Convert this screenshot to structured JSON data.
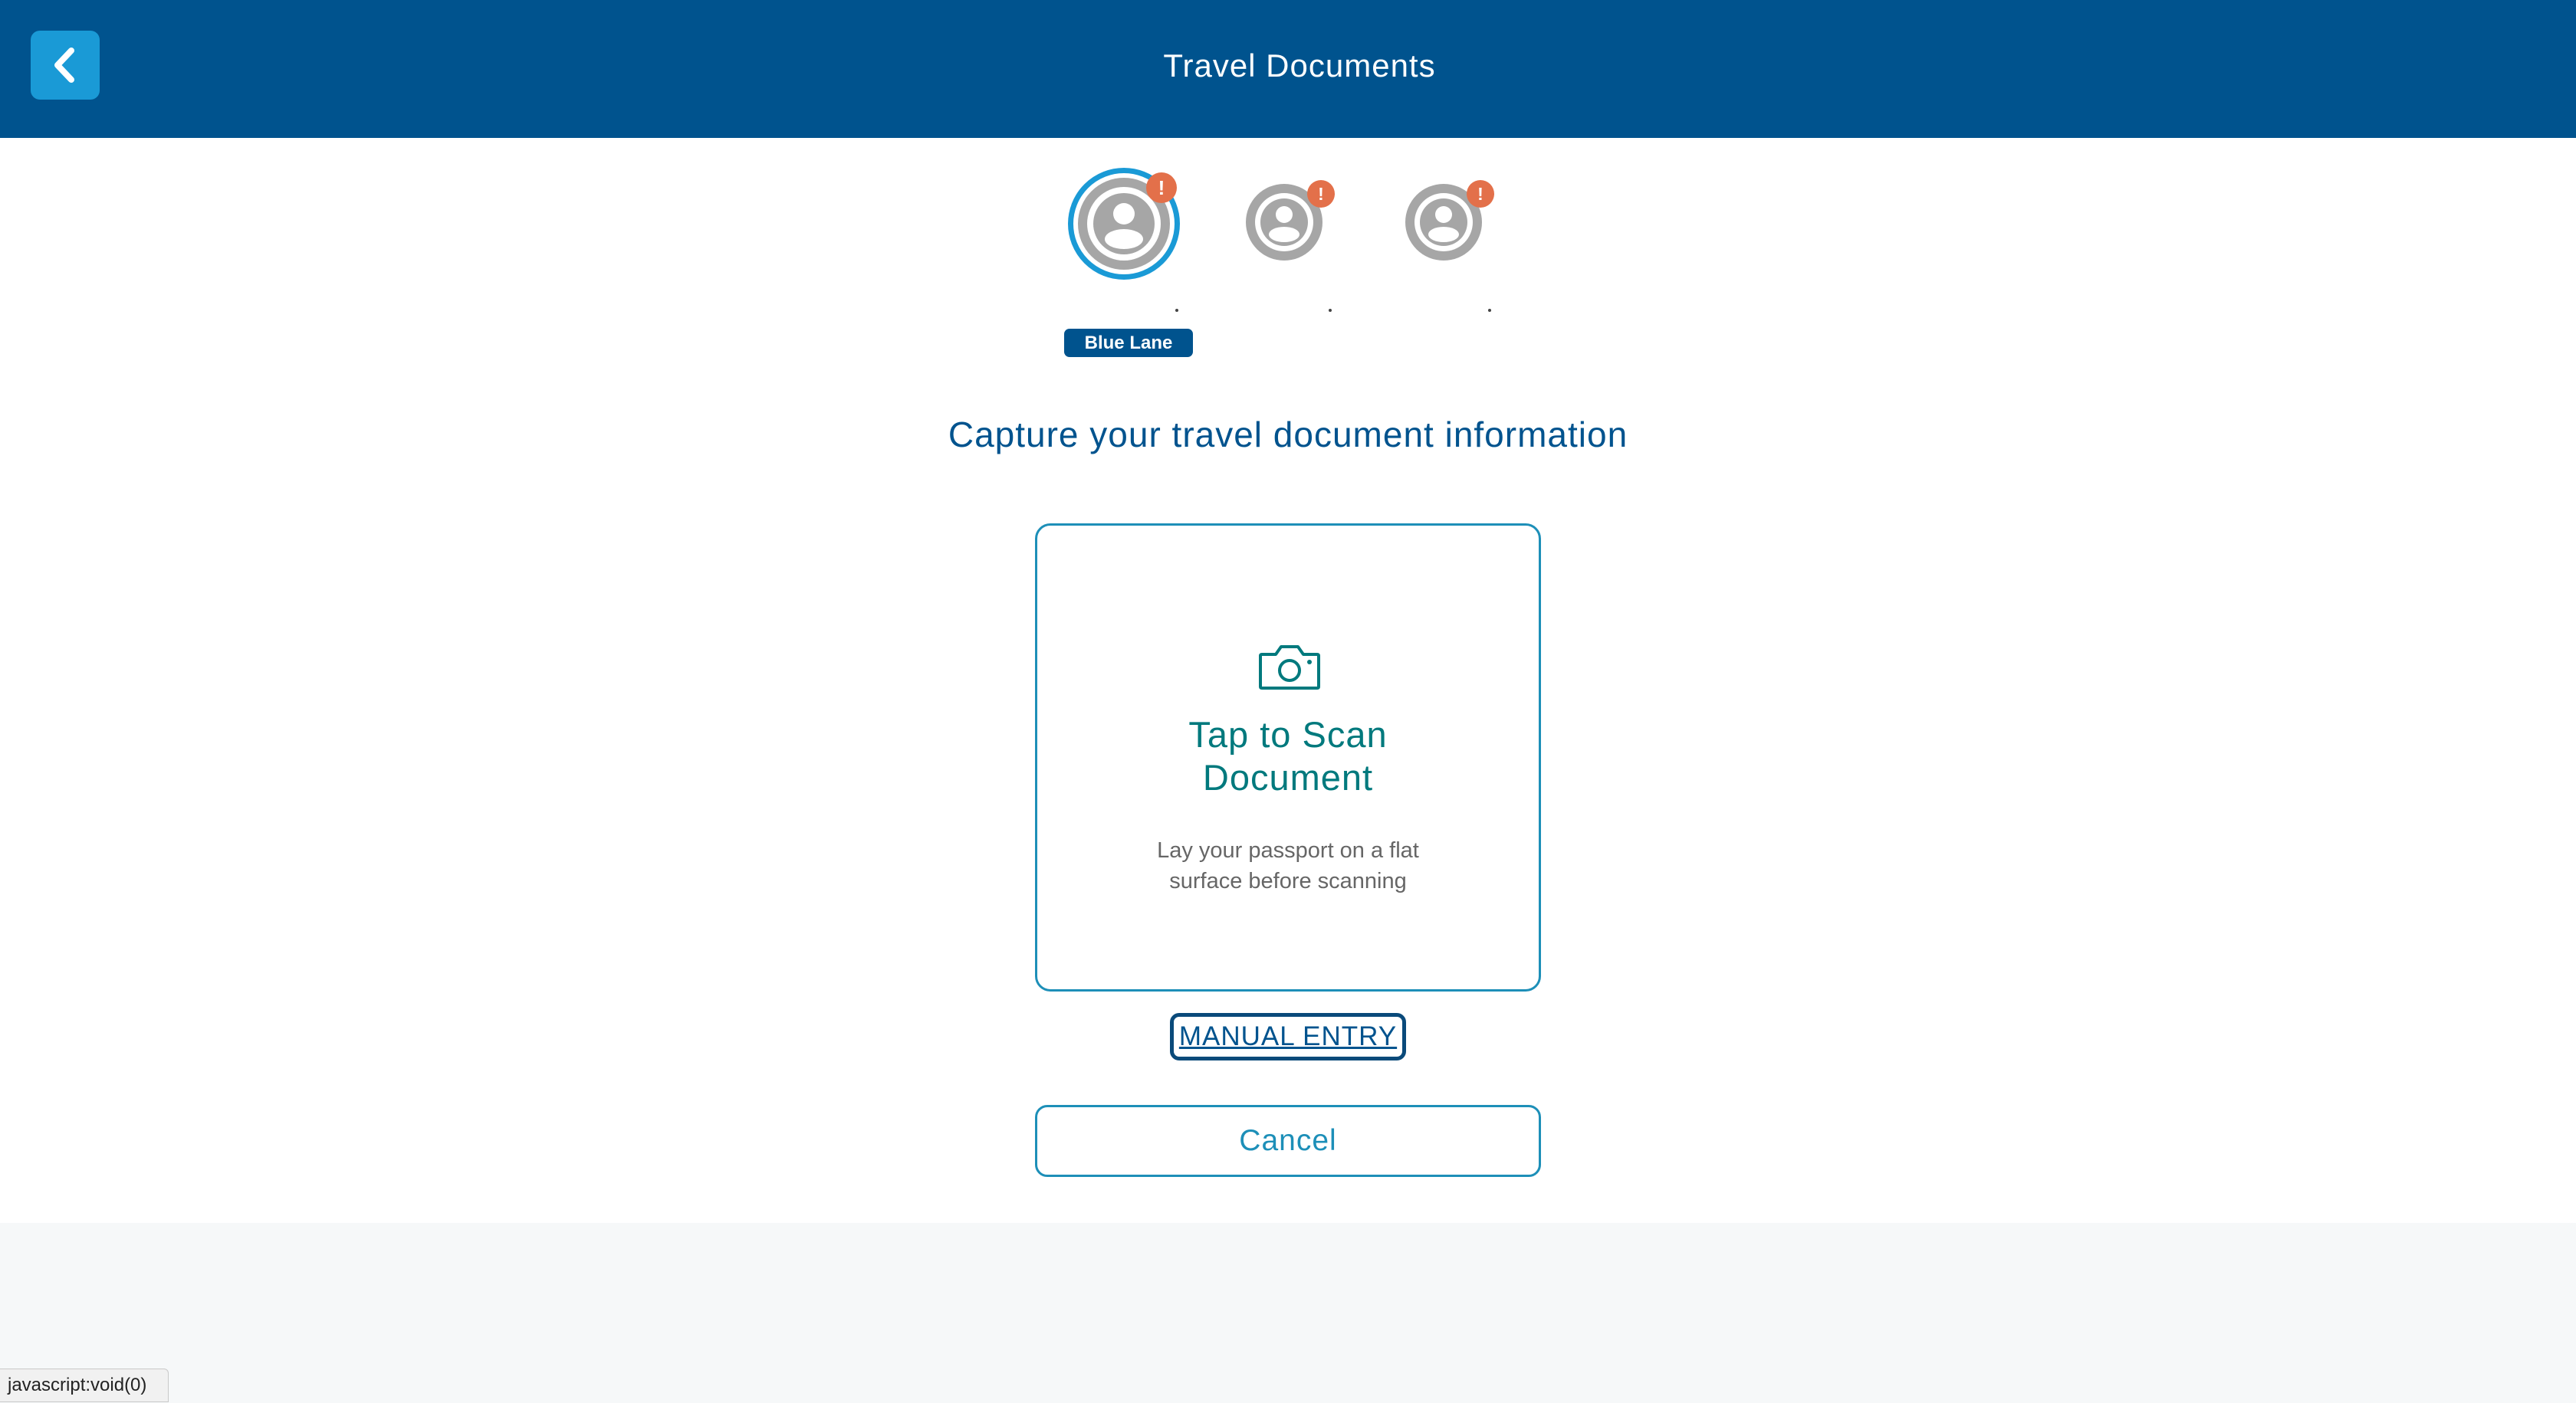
{
  "header": {
    "title": "Travel Documents",
    "back_icon": "chevron-left-icon"
  },
  "travelers": [
    {
      "selected": true,
      "alert": "!",
      "dot": "."
    },
    {
      "selected": false,
      "alert": "!",
      "dot": "."
    },
    {
      "selected": false,
      "alert": "!",
      "dot": "."
    }
  ],
  "badge": {
    "label": "Blue Lane"
  },
  "main": {
    "heading": "Capture your travel document information",
    "scan": {
      "icon": "camera-icon",
      "title": "Tap to Scan Document",
      "hint": "Lay your passport on a flat surface before scanning"
    },
    "manual_entry": "MANUAL ENTRY",
    "cancel": "Cancel"
  },
  "status_bar": {
    "text": "javascript:void(0)"
  },
  "colors": {
    "header_bg": "#00538e",
    "back_button": "#1a9ad6",
    "alert": "#e3704a",
    "scan_accent": "#00797d",
    "cancel_border": "#1d8fb8"
  }
}
